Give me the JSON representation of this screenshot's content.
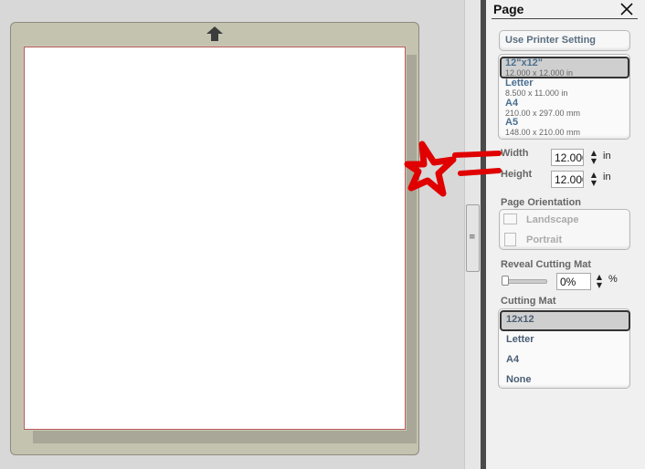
{
  "panel": {
    "title": "Page",
    "use_printer_setting": "Use Printer Setting",
    "sizes": [
      {
        "name": "12\"x12\"",
        "dims": "12.000 x 12.000 in"
      },
      {
        "name": "Letter",
        "dims": "8.500 x 11.000 in"
      },
      {
        "name": "A4",
        "dims": "210.00 x 297.00 mm"
      },
      {
        "name": "A5",
        "dims": "148.00 x 210.00 mm"
      }
    ],
    "width_label": "Width",
    "width_value": "12.000",
    "height_label": "Height",
    "height_value": "12.000",
    "unit": "in",
    "orientation_label": "Page Orientation",
    "landscape": "Landscape",
    "portrait": "Portrait",
    "reveal_label": "Reveal Cutting Mat",
    "reveal_value": "0%",
    "reveal_unit": "%",
    "reveal_level": 0,
    "mat_label": "Cutting Mat",
    "mats": [
      "12x12",
      "Letter",
      "A4",
      "None"
    ],
    "selected_mat": "12x12",
    "selected_size": "12\"x12\""
  },
  "colors": {
    "mat": "#c4c3b0",
    "selected_item": "#cfcfcf",
    "annotation": "#e00000"
  },
  "icons": {
    "close": "close-icon",
    "scroll_up": "up-arrow-icon"
  }
}
